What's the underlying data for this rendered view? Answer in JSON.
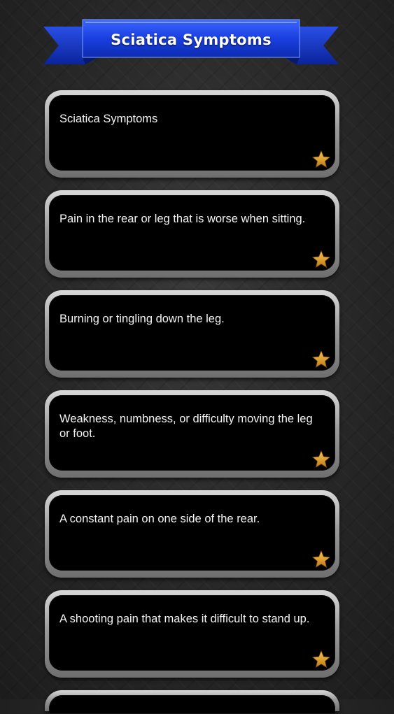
{
  "header": {
    "title": "Sciatica Symptoms"
  },
  "colors": {
    "ribbon_blue": "#1a3fe0",
    "star_gold": "#e0a12b",
    "card_bg": "#000000"
  },
  "items": [
    {
      "text": "Sciatica Symptoms",
      "icon": "star-icon"
    },
    {
      "text": "Pain in the rear or leg that is worse when sitting.",
      "icon": "star-icon"
    },
    {
      "text": "Burning or tingling down the leg.",
      "icon": "star-icon"
    },
    {
      "text": "Weakness, numbness, or difficulty moving the leg or foot.",
      "icon": "star-icon"
    },
    {
      "text": "A constant pain on one side of the rear.",
      "icon": "star-icon"
    },
    {
      "text": "A shooting pain that makes it difficult to stand up.",
      "icon": "star-icon"
    }
  ]
}
